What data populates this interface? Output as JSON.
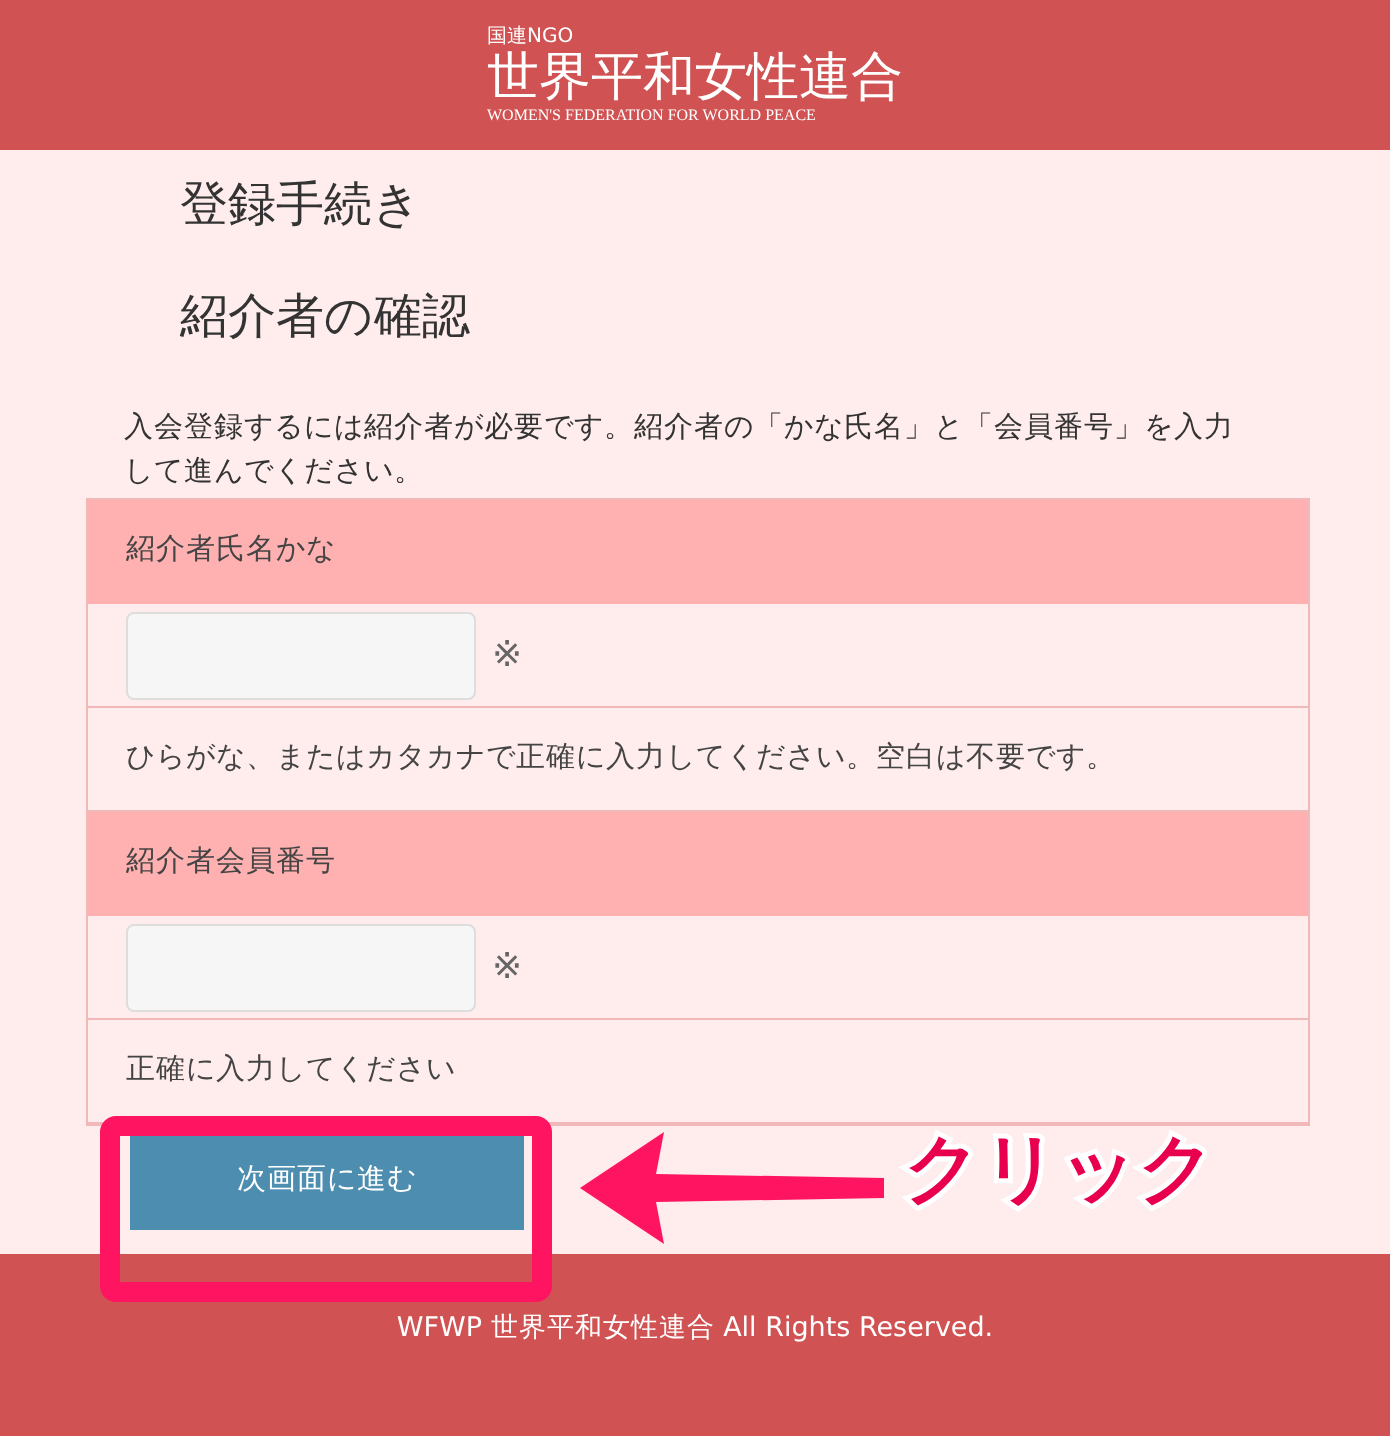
{
  "header": {
    "logo_small": "国連NGO",
    "logo_main": "世界平和女性連合",
    "logo_sub": "WOMEN'S FEDERATION FOR WORLD PEACE"
  },
  "titles": [
    "登録手続き",
    "紹介者の確認"
  ],
  "description": "入会登録するには紹介者が必要です。紹介者の「かな氏名」と「会員番号」を入力して進んでください。",
  "fields": [
    {
      "label": "紹介者氏名かな",
      "required_mark": "※",
      "note": "ひらがな、またはカタカナで正確に入力してください。空白は不要です。"
    },
    {
      "label": "紹介者会員番号",
      "required_mark": "※",
      "note": "正確に入力してください"
    }
  ],
  "submit_button": "次画面に進む",
  "annotation": {
    "text": "クリック"
  },
  "footer": "WFWP 世界平和女性連合 All Rights Reserved."
}
